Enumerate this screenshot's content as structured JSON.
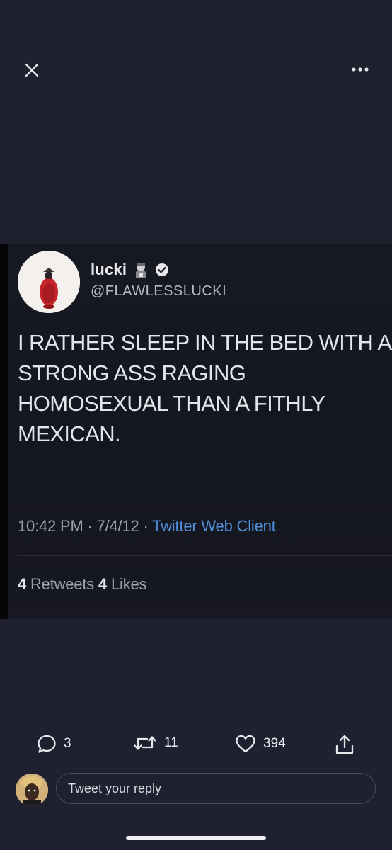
{
  "viewer": {
    "close_icon": "close-icon",
    "more_icon": "more-horizontal-icon"
  },
  "embedded_tweet": {
    "name": "lucki",
    "handle": "@FLAWLESSLUCKI",
    "text": "I RATHER SLEEP IN THE BED WITH A\nSTRONG ASS RAGING\nHOMOSEXUAL THAN A FITHLY\nMEXICAN.",
    "time": "10:42 PM",
    "date": "7/4/12",
    "client": "Twitter Web Client",
    "retweets_count": "4",
    "retweets_label": "Retweets",
    "likes_count": "4",
    "likes_label": "Likes"
  },
  "actions": {
    "replies": "3",
    "retweets": "11",
    "likes": "394"
  },
  "reply": {
    "placeholder": "Tweet your reply"
  },
  "colors": {
    "background": "#1f2131",
    "link_blue": "#4f8ed8",
    "verified": "#e8e8ec"
  }
}
